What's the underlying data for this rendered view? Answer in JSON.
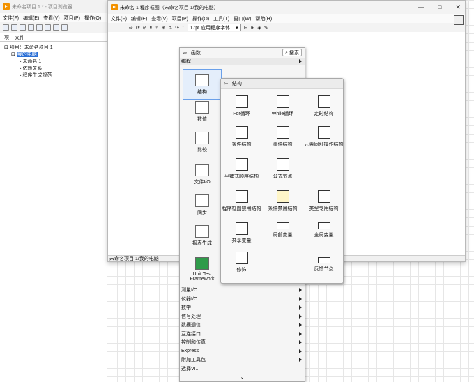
{
  "project_window": {
    "title": "未命名项目 1 * - 项目浏览器",
    "menu": [
      "文件(F)",
      "编辑(E)",
      "查看(V)",
      "项目(P)",
      "操作(O)"
    ],
    "tabs": [
      "项",
      "文件"
    ],
    "tree": [
      "项目：未命名项目 1",
      "我的电脑",
      "未命名 1",
      "依赖关系",
      "程序生成规范"
    ]
  },
  "block_diagram": {
    "title": "未命名 1 程序框图（未命名项目 1/我的电脑）",
    "menu": [
      "文件(F)",
      "编辑(E)",
      "查看(V)",
      "项目(P)",
      "操作(O)",
      "工具(T)",
      "窗口(W)",
      "帮助(H)"
    ],
    "font_select": "17pt 应用程序字体",
    "status": "未命名项目 1/我的电脑",
    "win_buttons": [
      "—",
      "□",
      "✕"
    ]
  },
  "functions_palette": {
    "title": "函数",
    "search_label": "搜索",
    "category": "编程",
    "items": [
      "结构",
      "数值",
      "比较",
      "文件I/O",
      "同步",
      "报表生成",
      "Unit Test Framework"
    ],
    "bottom_list": [
      "测量I/O",
      "仪器I/O",
      "数学",
      "信号处理",
      "数据通信",
      "互连接口",
      "控制和仿真",
      "Express",
      "附加工具包",
      "选择VI..."
    ],
    "more": "⌄"
  },
  "structures_palette": {
    "title": "结构",
    "items": [
      "For循环",
      "While循环",
      "定时结构",
      "条件结构",
      "事件结构",
      "元素同址操作结构",
      "平铺式顺序结构",
      "公式节点",
      "",
      "程序框图禁用结构",
      "条件禁用结构",
      "类型专用结构",
      "共享变量",
      "局部变量",
      "全局变量",
      "修饰",
      "",
      "反馈节点"
    ]
  }
}
